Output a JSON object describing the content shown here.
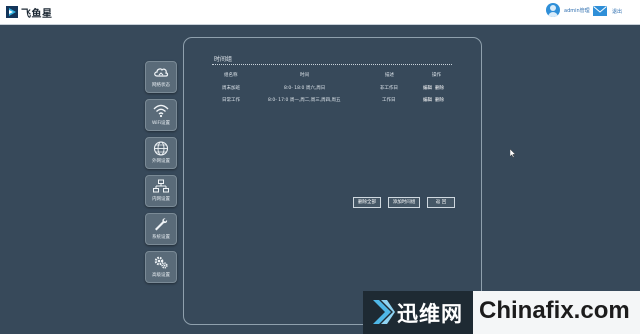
{
  "header": {
    "brand": "飞鱼星",
    "user_label": "admin管理",
    "logout": "退出"
  },
  "nav": [
    {
      "label": "网络状态",
      "icon": "cloud-icon"
    },
    {
      "label": "WiFi设置",
      "icon": "wifi-icon"
    },
    {
      "label": "外网设置",
      "icon": "globe-icon"
    },
    {
      "label": "内网设置",
      "icon": "network-icon"
    },
    {
      "label": "系统设置",
      "icon": "wrench-icon"
    },
    {
      "label": "高级设置",
      "icon": "gears-icon"
    }
  ],
  "panel": {
    "title": "时间组",
    "columns": [
      "组名称",
      "时间",
      "描述",
      "操作"
    ],
    "rows": [
      {
        "name": "周末加班",
        "time": "8:0- 18:0 周六,周日",
        "desc": "非工作日",
        "edit": "编辑",
        "delete": "删除"
      },
      {
        "name": "日常工作",
        "time": "8:0- 17:0 周一,周二,周三,周四,周五",
        "desc": "工作日",
        "edit": "编辑",
        "delete": "删除"
      }
    ],
    "buttons": {
      "delete_all": "删除全部",
      "add_group": "添加时间组",
      "back": "返 回"
    }
  },
  "watermark": {
    "cn": "迅维网",
    "en": "Chinafix.com"
  },
  "colors": {
    "background": "#37495a",
    "topbar": "#ffffff",
    "accent": "#2f8fd8"
  }
}
